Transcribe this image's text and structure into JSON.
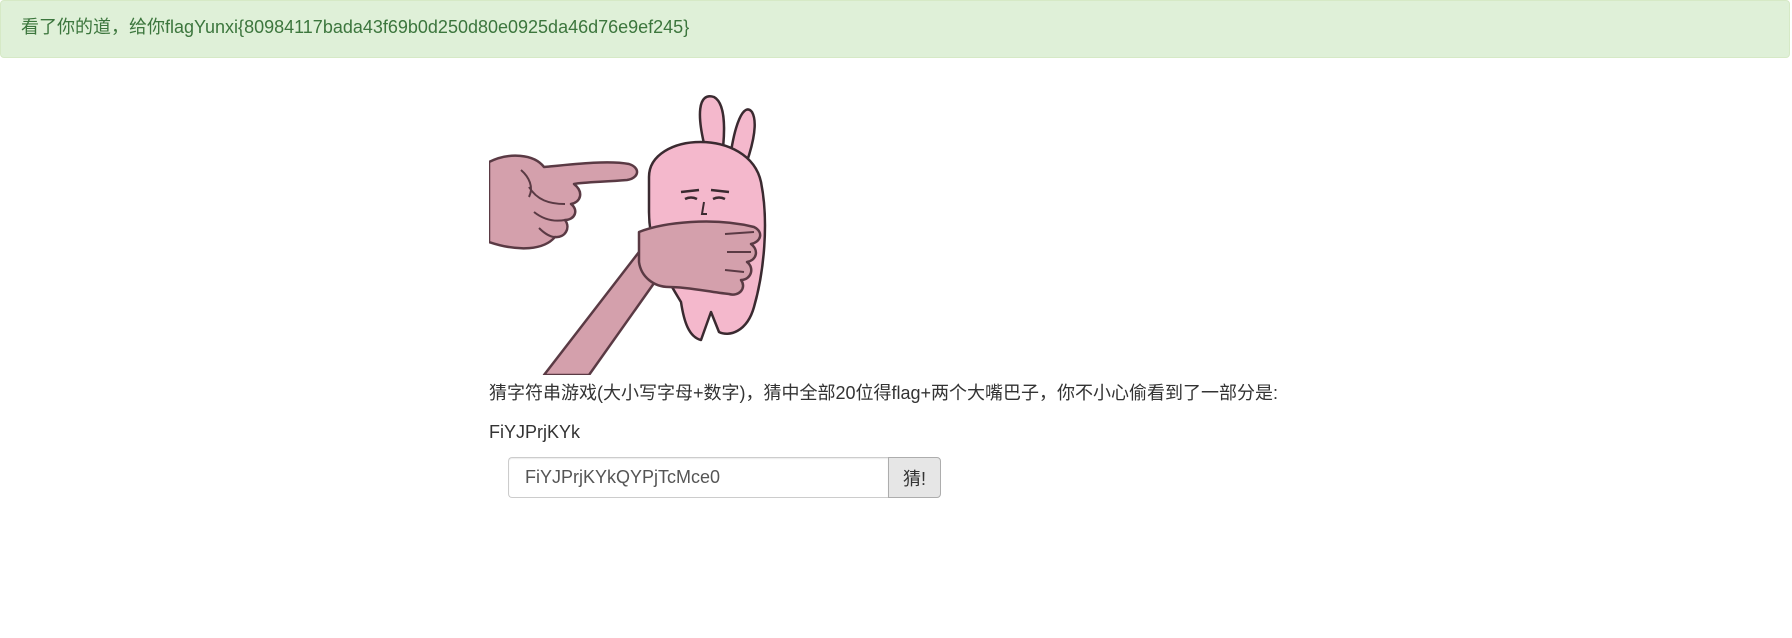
{
  "alert": {
    "message": "看了你的道，给你flagYunxi{80984117bada43f69b0d250d80e0925da46d76e9ef245}",
    "color": "#3c763d",
    "background": "#dff0d8"
  },
  "meme": {
    "description_icon": "pointing-hand-rabbit-meme"
  },
  "game": {
    "prompt": "猜字符串游戏(大小写字母+数字)，猜中全部20位得flag+两个大嘴巴子，你不小心偷看到了一部分是:",
    "hint": "FiYJPrjKYk"
  },
  "form": {
    "input_value": "FiYJPrjKYkQYPjTcMce0",
    "button_label": "猜!"
  }
}
